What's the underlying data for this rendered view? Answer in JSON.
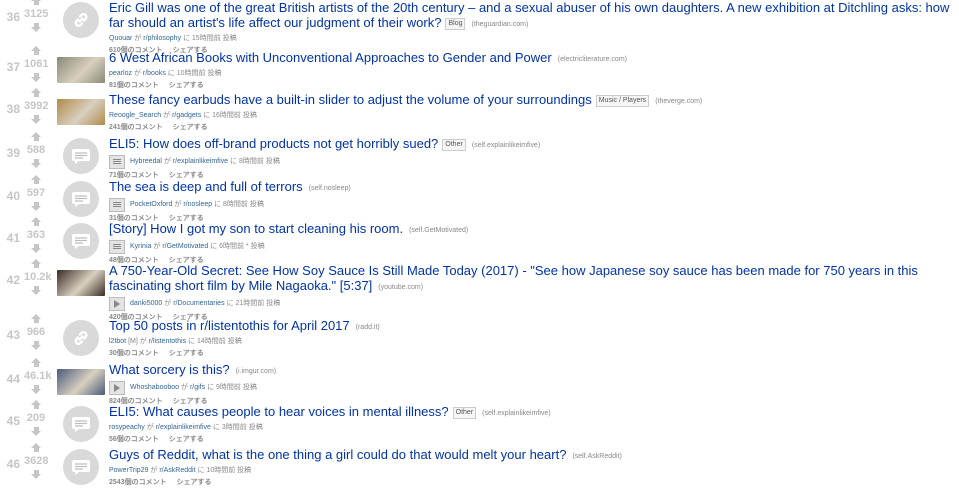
{
  "posts": [
    {
      "rank": "36",
      "score": "3125",
      "thumb": "link",
      "title": "Eric Gill was one of the great British artists of the 20th century – and a sexual abuser of his own daughters. A new exhibition at Ditchling asks: how far should an artist's life affect our judgment of their work?",
      "flair": "Blog",
      "domain": "(theguardian.com)",
      "expando": "",
      "author": "Quouar",
      "by": "が",
      "subreddit": "r/philosophy",
      "time": "に 15時間前 投稿",
      "comments": "610個のコメント",
      "share": "シェアする"
    },
    {
      "rank": "37",
      "score": "1061",
      "thumb": "image",
      "thumb_color": "#8a8878",
      "title": "6 West African Books with Unconventional Approaches to Gender and Power",
      "flair": "",
      "domain": "(electricliterature.com)",
      "expando": "",
      "author": "pearloz",
      "by": "が",
      "subreddit": "r/books",
      "time": "に 10時間前 投稿",
      "comments": "81個のコメント",
      "share": "シェアする"
    },
    {
      "rank": "38",
      "score": "3992",
      "thumb": "image",
      "thumb_color": "#b08a4a",
      "title": "These fancy earbuds have a built-in slider to adjust the volume of your surroundings",
      "flair": "Music / Players",
      "domain": "(theverge.com)",
      "expando": "",
      "author": "Reoogle_Search",
      "by": "が",
      "subreddit": "r/gadgets",
      "time": "に 16時間前 投稿",
      "comments": "241個のコメント",
      "share": "シェアする"
    },
    {
      "rank": "39",
      "score": "588",
      "thumb": "self",
      "title": "ELI5: How does off-brand products not get horribly sued?",
      "flair": "Other",
      "domain": "(self.explainlikeimfive)",
      "expando": "text",
      "author": "Hybreedal",
      "by": "が",
      "subreddit": "r/explainlikeimfive",
      "time": "に 8時間前 投稿",
      "comments": "71個のコメント",
      "share": "シェアする"
    },
    {
      "rank": "40",
      "score": "597",
      "thumb": "self",
      "title": "The sea is deep and full of terrors",
      "flair": "",
      "domain": "(self.nosleep)",
      "expando": "text",
      "author": "PocketOxford",
      "by": "が",
      "subreddit": "r/nosleep",
      "time": "に 8時間前 投稿",
      "comments": "31個のコメント",
      "share": "シェアする"
    },
    {
      "rank": "41",
      "score": "363",
      "thumb": "self",
      "title": "[Story] How I got my son to start cleaning his room.",
      "flair": "",
      "domain": "(self.GetMotivated)",
      "expando": "text",
      "author": "Kyrinia",
      "by": "が",
      "subreddit": "r/GetMotivated",
      "time": "に 6時間前 * 投稿",
      "comments": "48個のコメント",
      "share": "シェアする"
    },
    {
      "rank": "42",
      "score": "10.2k",
      "thumb": "image",
      "thumb_color": "#3a2a22",
      "title": "A 750-Year-Old Secret: See How Soy Sauce Is Still Made Today (2017) - \"See how Japanese soy sauce has been made for 750 years in this fascinating short film by Mile Nagaoka.\" [5:37]",
      "flair": "",
      "domain": "(youtube.com)",
      "expando": "play",
      "author": "danki5000",
      "by": "が",
      "subreddit": "r/Documentaries",
      "time": "に 21時間前 投稿",
      "comments": "420個のコメント",
      "share": "シェアする"
    },
    {
      "rank": "43",
      "score": "966",
      "thumb": "link",
      "title": "Top 50 posts in r/listentothis for April 2017",
      "flair": "",
      "domain": "(radd.it)",
      "expando": "",
      "author": "l2tbot",
      "author_flair": "[M]",
      "by": "が",
      "subreddit": "r/listentothis",
      "time": "に 14時間前 投稿",
      "comments": "30個のコメント",
      "share": "シェアする"
    },
    {
      "rank": "44",
      "score": "46.1k",
      "thumb": "image",
      "thumb_color": "#4a5a7a",
      "title": "What sorcery is this?",
      "flair": "",
      "domain": "(i.imgur.com)",
      "expando": "play",
      "author": "Whoshabooboo",
      "by": "が",
      "subreddit": "r/gifs",
      "time": "に 9時間前 投稿",
      "comments": "824個のコメント",
      "share": "シェアする"
    },
    {
      "rank": "45",
      "score": "209",
      "thumb": "self",
      "title": "ELI5: What causes people to hear voices in mental illness?",
      "flair": "Other",
      "domain": "(self.explainlikeimfive)",
      "expando": "",
      "author": "rosypeachy",
      "by": "が",
      "subreddit": "r/explainlikeimfive",
      "time": "に 3時間前 投稿",
      "comments": "56個のコメント",
      "share": "シェアする"
    },
    {
      "rank": "46",
      "score": "3628",
      "thumb": "self",
      "title": "Guys of Reddit, what is the one thing a girl could do that would melt your heart?",
      "flair": "",
      "domain": "(self.AskReddit)",
      "expando": "",
      "author": "PowerTrip29",
      "by": "が",
      "subreddit": "r/AskReddit",
      "time": "に 10時間前 投稿",
      "comments": "2543個のコメント",
      "share": "シェアする"
    }
  ]
}
